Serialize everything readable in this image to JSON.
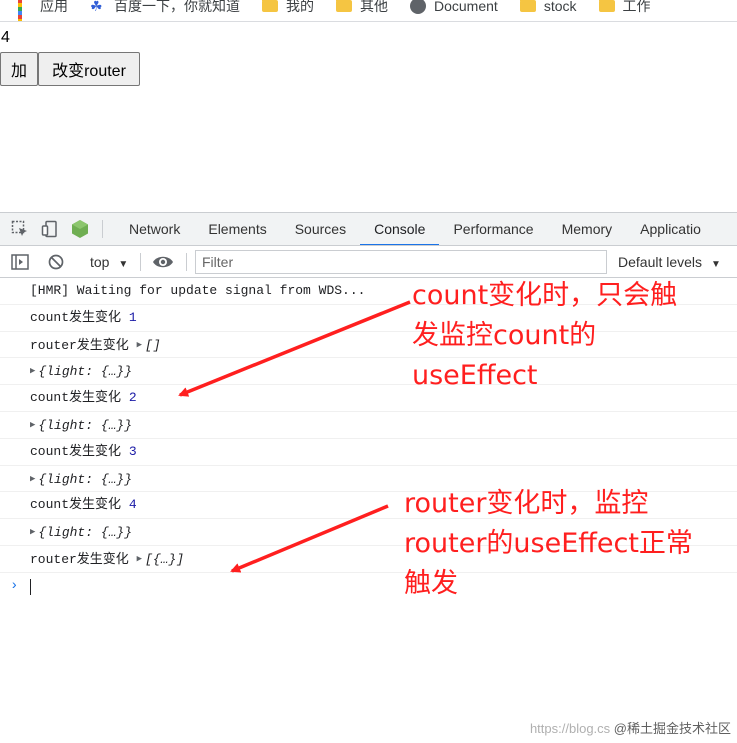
{
  "bookmarks": [
    {
      "label": "应用",
      "icon": "apps-grid-icon"
    },
    {
      "label": "百度一下，你就知道",
      "icon": "baidu-paw-icon"
    },
    {
      "label": "我的",
      "icon": "folder-icon"
    },
    {
      "label": "其他",
      "icon": "folder-icon"
    },
    {
      "label": "Document",
      "icon": "globe-icon"
    },
    {
      "label": "stock",
      "icon": "folder-icon"
    },
    {
      "label": "工作",
      "icon": "folder-icon"
    }
  ],
  "page": {
    "count": "4",
    "add_button": "加",
    "router_button": "改变router"
  },
  "devtools": {
    "tabs": [
      "Network",
      "Elements",
      "Sources",
      "Console",
      "Performance",
      "Memory",
      "Applicatio"
    ],
    "active_tab": "Console",
    "context": "top",
    "filter_placeholder": "Filter",
    "levels": "Default levels"
  },
  "console_rows": [
    {
      "text": "[HMR] Waiting for update signal from WDS..."
    },
    {
      "label": "count发生变化",
      "value": "1"
    },
    {
      "label": "router发生变化",
      "value": "[]"
    },
    {
      "object": "{light: {…}}"
    },
    {
      "label": "count发生变化",
      "value": "2"
    },
    {
      "object": "{light: {…}}"
    },
    {
      "label": "count发生变化",
      "value": "3"
    },
    {
      "object": "{light: {…}}"
    },
    {
      "label": "count发生变化",
      "value": "4"
    },
    {
      "object": "{light: {…}}"
    },
    {
      "label": "router发生变化",
      "value": "[{…}]"
    }
  ],
  "annotations": {
    "first": [
      "count变化时，只会触",
      "发监控count的",
      "useEffect"
    ],
    "second": [
      "router变化时，监控",
      "router的useEffect正常",
      "触发"
    ]
  },
  "watermark": {
    "faint": "https://blog.cs",
    "main": "@稀土掘金技术社区"
  },
  "colors": {
    "annotation": "#ff1f1f",
    "active_tab": "#1a73e8",
    "number": "#1a1aa6"
  }
}
